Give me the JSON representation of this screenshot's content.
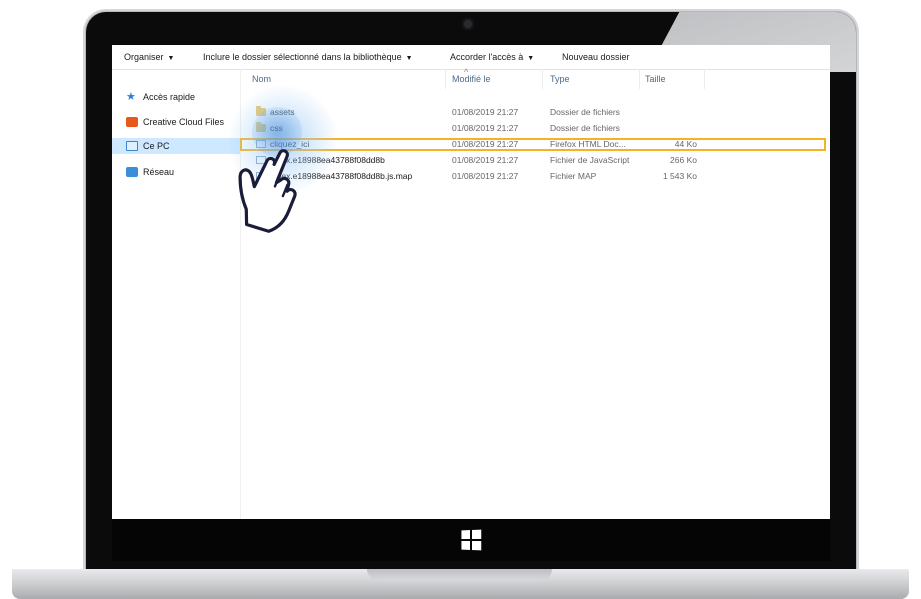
{
  "toolbar": {
    "organize": "Organiser",
    "include": "Inclure le dossier sélectionné dans la bibliothèque",
    "share": "Accorder l'accès à",
    "new_folder": "Nouveau dossier",
    "caret": "▼"
  },
  "nav": {
    "items": [
      {
        "label": "Accès rapide",
        "icon": "star-icon"
      },
      {
        "label": "Creative Cloud Files",
        "icon": "creative-cloud-icon"
      },
      {
        "label": "Ce PC",
        "icon": "computer-icon"
      },
      {
        "label": "Réseau",
        "icon": "network-icon"
      }
    ],
    "selected": "Ce PC"
  },
  "columns": {
    "name": "Nom",
    "modified": "Modifié le",
    "type": "Type",
    "size": "Taille"
  },
  "files": [
    {
      "name": "assets",
      "modified": "01/08/2019 21:27",
      "type": "Dossier de fichiers",
      "size": "",
      "icon": "folder-icon"
    },
    {
      "name": "css",
      "modified": "01/08/2019 21:27",
      "type": "Dossier de fichiers",
      "size": "",
      "icon": "folder-icon"
    },
    {
      "name": "cliquez_ici",
      "modified": "01/08/2019 21:27",
      "type": "Firefox HTML Doc...",
      "size": "44 Ko",
      "icon": "html-file-icon"
    },
    {
      "name": "index.e18988ea43788f08dd8b",
      "modified": "01/08/2019 21:27",
      "type": "Fichier de JavaScript",
      "size": "266 Ko",
      "icon": "js-file-icon"
    },
    {
      "name": "index.e18988ea43788f08dd8b.js.map",
      "modified": "01/08/2019 21:27",
      "type": "Fichier MAP",
      "size": "1 543 Ko",
      "icon": "map-file-icon"
    }
  ],
  "highlighted_file": "cliquez_ici",
  "colors": {
    "highlight": "#f5b323",
    "selection": "#cde8ff",
    "halo": "#5ea0e6"
  }
}
